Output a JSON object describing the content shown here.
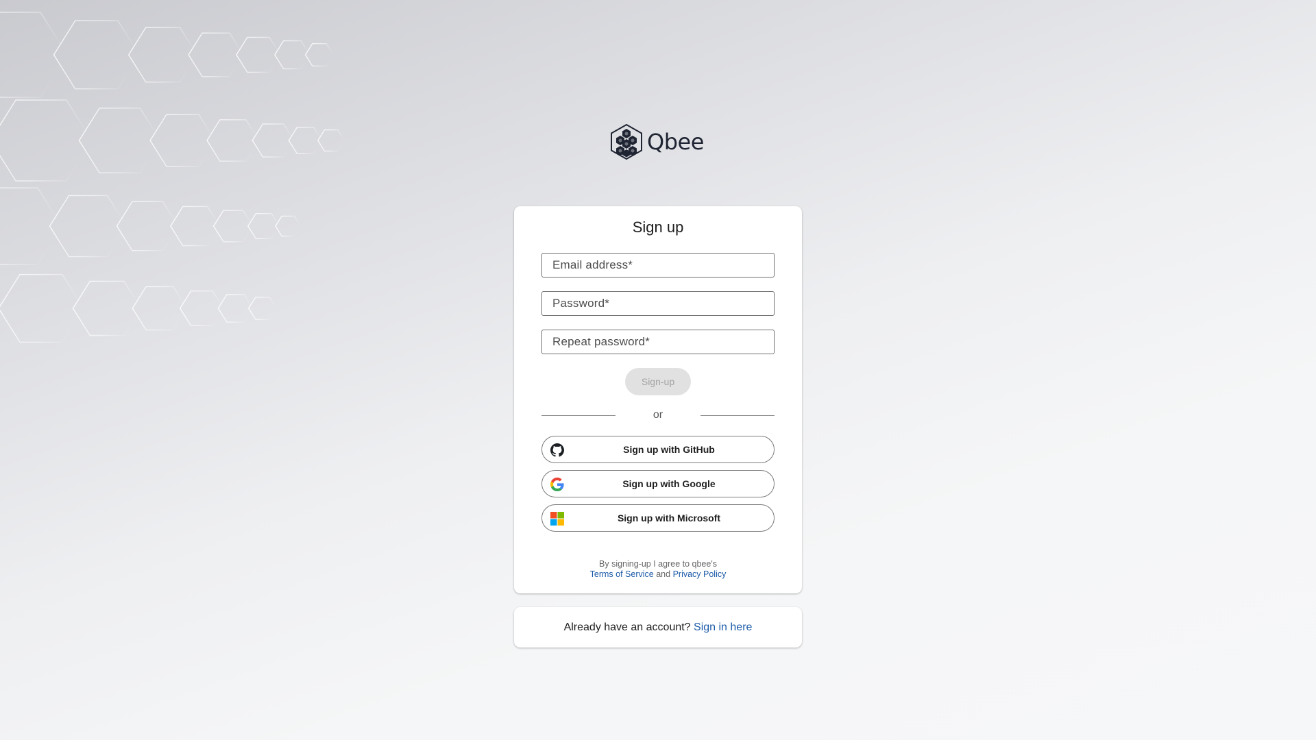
{
  "brand": {
    "name": "Qbee",
    "logo_icon": "hexagon-cluster-icon"
  },
  "signup_form": {
    "title": "Sign up",
    "email_placeholder": "Email address*",
    "password_placeholder": "Password*",
    "repeat_password_placeholder": "Repeat password*",
    "submit_label": "Sign-up",
    "submit_state": "disabled",
    "divider_text": "or",
    "sso": [
      {
        "label": "Sign up with GitHub",
        "icon": "github-icon"
      },
      {
        "label": "Sign up with Google",
        "icon": "google-icon"
      },
      {
        "label": "Sign up with Microsoft",
        "icon": "microsoft-icon"
      }
    ],
    "legal": {
      "prefix": "By signing-up I agree to qbee's",
      "terms_label": "Terms of Service",
      "and_text": "and",
      "privacy_label": "Privacy Policy"
    }
  },
  "signin_prompt": {
    "text": "Already have an account?",
    "link_label": "Sign in here"
  },
  "colors": {
    "link": "#1c5ba8",
    "brand_dark": "#1f2433",
    "card_background": "#ffffff",
    "disabled_button": "#e1e1e1"
  }
}
